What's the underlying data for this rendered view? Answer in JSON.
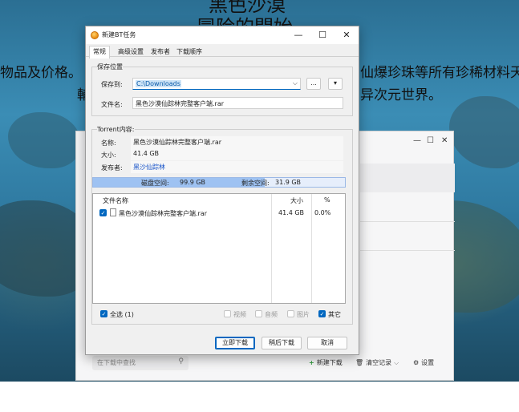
{
  "background": {
    "title_line1": "黑色沙漠",
    "title_line2": "冒险的開始",
    "text_left": "物品及价格。",
    "text_left2": "輔",
    "text_right": "仙爆珍珠等所有珍稀材料天",
    "text_right2": "异次元世界。"
  },
  "behind_window": {
    "controls": {
      "minimize": "—",
      "maximize": "☐",
      "close": "✕"
    },
    "search_placeholder": "在下载中查找",
    "new_download": "新建下载",
    "clear_records": "清空记录",
    "settings": "设置",
    "icons": {
      "search": "search-icon",
      "plus": "plus-icon",
      "trash": "trash-icon",
      "gear": "gear-icon"
    }
  },
  "dialog": {
    "title": "新建BT任务",
    "controls": {
      "minimize": "—",
      "maximize": "☐",
      "close": "✕"
    },
    "tabs": [
      {
        "label": "常规",
        "active": true
      },
      {
        "label": "高级设置",
        "active": false
      },
      {
        "label": "发布者",
        "active": false
      },
      {
        "label": "下载顺序",
        "active": false
      }
    ],
    "save_location": {
      "group_title": "保存位置",
      "save_to_label": "保存到:",
      "save_to_value": "C:\\Downloads",
      "browse_button": "...",
      "dropdown_button": "▾",
      "file_name_label": "文件名:",
      "file_name_value": "黑色沙漠仙踪林完整客户端.rar"
    },
    "torrent": {
      "group_title": "Torrent内容:",
      "name_label": "名称:",
      "name_value": "黑色沙漠仙踪林完整客户端.rar",
      "size_label": "大小:",
      "size_value": "41.4 GB",
      "publisher_label": "发布者:",
      "publisher_value": "黑沙仙踪林",
      "disk_space_label": "磁盘空间:",
      "disk_space_value": "99.9 GB",
      "remaining_label": "剩余空间:",
      "remaining_value": "31.9 GB",
      "disk_used_fraction": 0.68
    },
    "file_list": {
      "columns": {
        "name": "文件名称",
        "size": "大小",
        "percent": "%"
      },
      "rows": [
        {
          "checked": true,
          "name": "黑色沙漠仙踪林完整客户端.rar",
          "size": "41.4 GB",
          "percent": "0.0%"
        }
      ]
    },
    "filters": {
      "select_all": "全选 (1)",
      "video": "视频",
      "audio": "音频",
      "image": "图片",
      "other": "其它"
    },
    "buttons": {
      "download_now": "立即下载",
      "download_later": "稍后下载",
      "cancel": "取消"
    },
    "colors": {
      "accent": "#0067c0",
      "link": "#1a55c9",
      "disk_bar": "#9ec2f2"
    }
  }
}
